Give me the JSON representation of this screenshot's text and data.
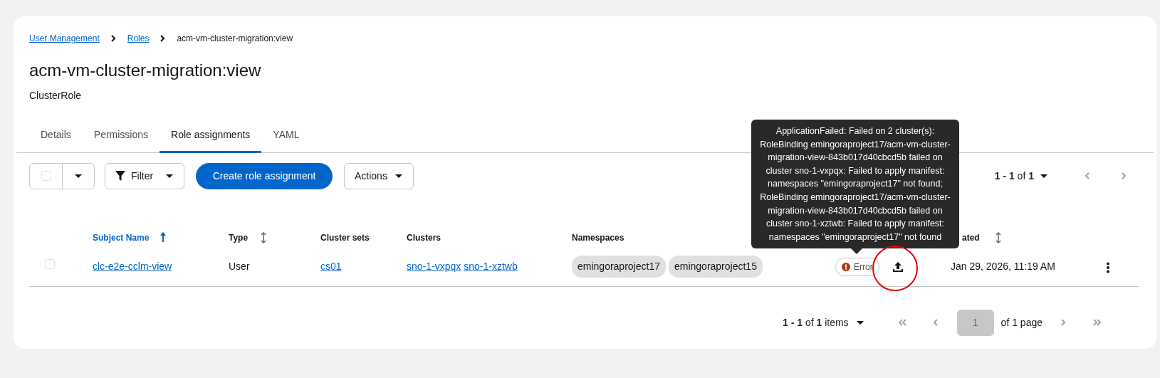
{
  "breadcrumb": [
    {
      "label": "User Management",
      "link": true
    },
    {
      "label": "Roles",
      "link": true
    },
    {
      "label": "acm-vm-cluster-migration:view",
      "link": false
    }
  ],
  "title": "acm-vm-cluster-migration:view",
  "subtitle": "ClusterRole",
  "tabs": [
    {
      "label": "Details",
      "selected": false
    },
    {
      "label": "Permissions",
      "selected": false
    },
    {
      "label": "Role assignments",
      "selected": true
    },
    {
      "label": "YAML",
      "selected": false
    }
  ],
  "toolbar": {
    "bulk_select": {
      "checked": false
    },
    "filter_button": "Filter",
    "primary_button": "Create role assignment",
    "actions_button": "Actions",
    "pagination": "**1 - 1** of **1**"
  },
  "table": {
    "columns": [
      {
        "label": "Subject Name",
        "sortable": true,
        "sorted": true
      },
      {
        "label": "Type",
        "sortable": true,
        "sorted": false
      },
      {
        "label": "Cluster sets"
      },
      {
        "label": "Clusters"
      },
      {
        "label": "Namespaces"
      },
      {
        "label": "ated",
        "sortable": true,
        "sorted": false
      }
    ],
    "rows": [
      {
        "selected": false,
        "subject": "clc-e2e-cclm-view",
        "type": "User",
        "cluster_sets": [
          "cs01"
        ],
        "clusters": [
          "sno-1-vxpqx",
          "sno-1-xztwb"
        ],
        "namespaces": [
          "emingoraproject17",
          "emingoraproject15"
        ],
        "status": {
          "label": "Error",
          "kind": "error"
        },
        "created": "Jan 29, 2026, 11:19 AM"
      }
    ]
  },
  "tooltip": {
    "text": "ApplicationFailed: Failed on 2 cluster(s): RoleBinding emingoraproject17/acm-vm-cluster-migration-view-843b017d40cbcd5b failed on cluster sno-1-vxpqx: Failed to apply manifest: namespaces \"emingoraproject17\" not found; RoleBinding emingoraproject17/acm-vm-cluster-migration-view-843b017d40cbcd5b failed on cluster sno-1-xztwb: Failed to apply manifest: namespaces \"emingoraproject17\" not found"
  },
  "pagination": {
    "summary": "**1 - 1** of **1** items",
    "page": "1",
    "page_total": "of 1 page"
  }
}
